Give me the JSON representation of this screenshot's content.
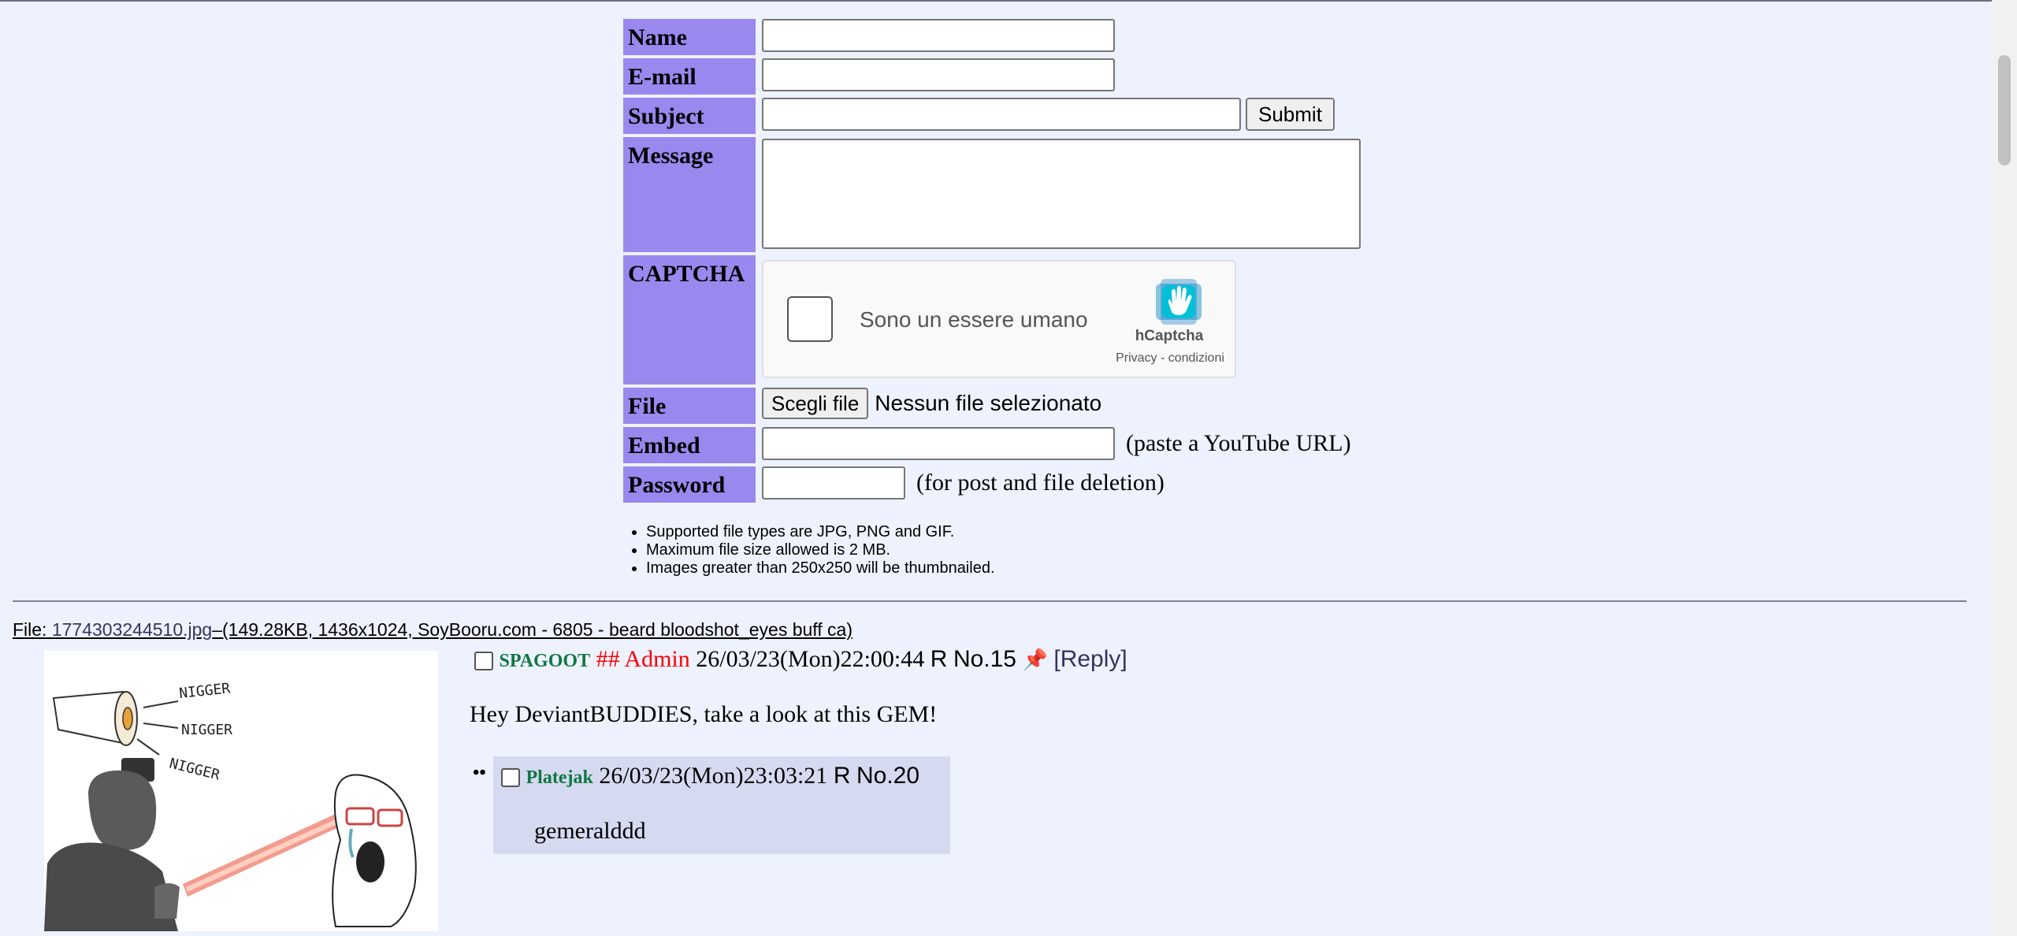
{
  "form": {
    "name_label": "Name",
    "email_label": "E-mail",
    "subject_label": "Subject",
    "submit_label": "Submit",
    "message_label": "Message",
    "captcha_label": "CAPTCHA",
    "captcha": {
      "checkbox_text": "Sono un essere umano",
      "brand": "hCaptcha",
      "terms": "Privacy - condizioni"
    },
    "file_label": "File",
    "file_button": "Scegli file",
    "file_status": "Nessun file selezionato",
    "embed_label": "Embed",
    "embed_hint": "(paste a YouTube URL)",
    "password_label": "Password",
    "password_hint": "(for post and file deletion)",
    "rules": [
      "Supported file types are JPG, PNG and GIF.",
      "Maximum file size allowed is 2 MB.",
      "Images greater than 250x250 will be thumbnailed."
    ]
  },
  "thread": {
    "file_prefix": "File: ",
    "file_name": "1774303244510.jpg",
    "file_meta": "–(149.28KB, 1436x1024, SoyBooru.com - 6805 - beard bloodshot_eyes buff ca)",
    "thumbnail_labels": [
      "NIGGER",
      "NIGGER",
      "NIGGER"
    ],
    "op": {
      "name": "SPAGOOT",
      "trip": "## Admin",
      "date": "26/03/23(Mon)22:00:44",
      "r": "R",
      "number": "No.15",
      "reply_link": "[Reply]",
      "pin_icon": "pushpin-icon",
      "message": "Hey DeviantBUDDIES, take a look at this GEM!"
    },
    "replies": [
      {
        "marker": "••",
        "name": "Platejak",
        "date": "26/03/23(Mon)23:03:21",
        "r": "R",
        "number": "No.20",
        "message": "gemeralddd"
      }
    ]
  },
  "colors": {
    "background": "#eef2ff",
    "label_bg": "#9988ee",
    "name": "#117743",
    "trip": "#ff0000",
    "reply_bg": "#d6daf0",
    "link": "#34345c"
  }
}
